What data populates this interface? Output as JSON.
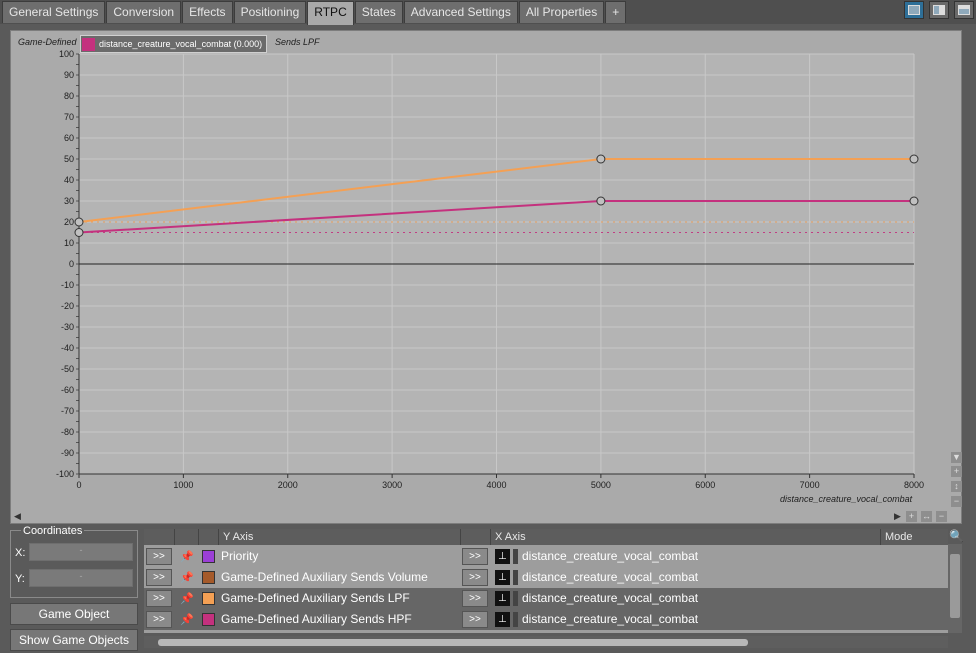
{
  "tabs": [
    {
      "label": "General Settings",
      "active": false
    },
    {
      "label": "Conversion",
      "active": false
    },
    {
      "label": "Effects",
      "active": false
    },
    {
      "label": "Positioning",
      "active": false
    },
    {
      "label": "RTPC",
      "active": true
    },
    {
      "label": "States",
      "active": false
    },
    {
      "label": "Advanced Settings",
      "active": false
    },
    {
      "label": "All Properties",
      "active": false
    },
    {
      "label": "+",
      "active": false
    }
  ],
  "graph": {
    "title_left": "Game-Defined",
    "title_right": "Sends LPF",
    "legend_label": "distance_creature_vocal_combat (0.000)",
    "legend_color": "#c4317e",
    "x_axis_name": "distance_creature_vocal_combat"
  },
  "chart_data": {
    "type": "line",
    "xlabel": "distance_creature_vocal_combat",
    "xlim": [
      0,
      8000
    ],
    "ylim": [
      -100,
      100
    ],
    "x_ticks": [
      0,
      1000,
      2000,
      3000,
      4000,
      5000,
      6000,
      7000,
      8000
    ],
    "y_ticks": [
      100,
      90,
      80,
      70,
      60,
      50,
      40,
      30,
      20,
      10,
      0,
      -10,
      -20,
      -30,
      -40,
      -50,
      -60,
      -70,
      -80,
      -90,
      -100
    ],
    "grid": true,
    "series": [
      {
        "name": "Game-Defined Auxiliary Sends LPF",
        "color": "#f4a054",
        "points": [
          [
            0,
            20
          ],
          [
            5000,
            50
          ],
          [
            8000,
            50
          ]
        ],
        "reference": 20
      },
      {
        "name": "Game-Defined Auxiliary Sends HPF",
        "color": "#c4317e",
        "points": [
          [
            0,
            15
          ],
          [
            5000,
            30
          ],
          [
            8000,
            30
          ]
        ],
        "reference": 15
      }
    ]
  },
  "coordinates": {
    "title": "Coordinates",
    "x_label": "X:",
    "y_label": "Y:",
    "x_value": "-",
    "y_value": "-"
  },
  "buttons": {
    "game_object_explorer": "Game Object Explorer...",
    "show_game_objects": "Show Game Objects"
  },
  "table": {
    "headers": {
      "y_axis": "Y Axis",
      "x_axis": "X Axis",
      "mode": "Mode"
    },
    "rows": [
      {
        "expand": ">>",
        "y_axis": "Priority",
        "color": "#9b3fd6",
        "x_expand": ">>",
        "x_axis": "distance_creature_vocal_combat",
        "selected": false
      },
      {
        "expand": ">>",
        "y_axis": "Game-Defined Auxiliary Sends Volume",
        "color": "#a55a2a",
        "x_expand": ">>",
        "x_axis": "distance_creature_vocal_combat",
        "selected": false
      },
      {
        "expand": ">>",
        "y_axis": "Game-Defined Auxiliary Sends LPF",
        "color": "#f4a054",
        "x_expand": ">>",
        "x_axis": "distance_creature_vocal_combat",
        "selected": true
      },
      {
        "expand": ">>",
        "y_axis": "Game-Defined Auxiliary Sends HPF",
        "color": "#c4317e",
        "x_expand": ">>",
        "x_axis": "distance_creature_vocal_combat",
        "selected": true
      }
    ]
  }
}
